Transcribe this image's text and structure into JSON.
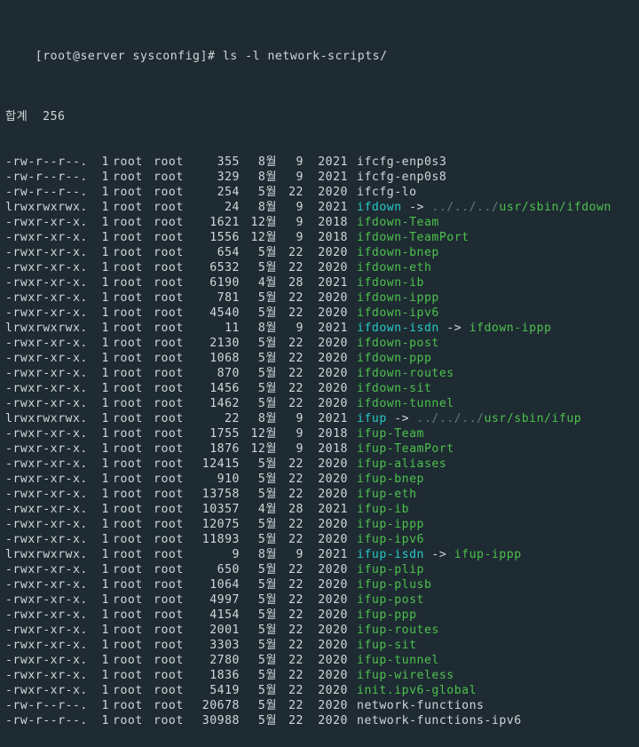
{
  "prompt": {
    "user": "root",
    "host": "server",
    "cwd": "sysconfig",
    "symbol": "#",
    "command": "ls -l network-scripts/"
  },
  "total_line": "합계  256",
  "name_colors": {
    "plain": "c-white",
    "exec": "c-green",
    "link": "c-cyan",
    "dim": "c-dim"
  },
  "rows": [
    {
      "perm": "-rw-r--r--.",
      "links": "1",
      "owner": "root",
      "group": "root",
      "size": "355",
      "month": "8월",
      "day": "9",
      "year": "2021",
      "seg": [
        {
          "t": "ifcfg-enp0s3",
          "c": "plain"
        }
      ]
    },
    {
      "perm": "-rw-r--r--.",
      "links": "1",
      "owner": "root",
      "group": "root",
      "size": "329",
      "month": "8월",
      "day": "9",
      "year": "2021",
      "seg": [
        {
          "t": "ifcfg-enp0s8",
          "c": "plain"
        }
      ]
    },
    {
      "perm": "-rw-r--r--.",
      "links": "1",
      "owner": "root",
      "group": "root",
      "size": "254",
      "month": "5월",
      "day": "22",
      "year": "2020",
      "seg": [
        {
          "t": "ifcfg-lo",
          "c": "plain"
        }
      ]
    },
    {
      "perm": "lrwxrwxrwx.",
      "links": "1",
      "owner": "root",
      "group": "root",
      "size": "24",
      "month": "8월",
      "day": "9",
      "year": "2021",
      "seg": [
        {
          "t": "ifdown",
          "c": "link"
        },
        {
          "t": " -> ",
          "c": "plain"
        },
        {
          "t": "../../../",
          "c": "dim"
        },
        {
          "t": "usr/sbin/ifdown",
          "c": "exec"
        }
      ]
    },
    {
      "perm": "-rwxr-xr-x.",
      "links": "1",
      "owner": "root",
      "group": "root",
      "size": "1621",
      "month": "12월",
      "day": "9",
      "year": "2018",
      "seg": [
        {
          "t": "ifdown-Team",
          "c": "exec"
        }
      ]
    },
    {
      "perm": "-rwxr-xr-x.",
      "links": "1",
      "owner": "root",
      "group": "root",
      "size": "1556",
      "month": "12월",
      "day": "9",
      "year": "2018",
      "seg": [
        {
          "t": "ifdown-TeamPort",
          "c": "exec"
        }
      ]
    },
    {
      "perm": "-rwxr-xr-x.",
      "links": "1",
      "owner": "root",
      "group": "root",
      "size": "654",
      "month": "5월",
      "day": "22",
      "year": "2020",
      "seg": [
        {
          "t": "ifdown-bnep",
          "c": "exec"
        }
      ]
    },
    {
      "perm": "-rwxr-xr-x.",
      "links": "1",
      "owner": "root",
      "group": "root",
      "size": "6532",
      "month": "5월",
      "day": "22",
      "year": "2020",
      "seg": [
        {
          "t": "ifdown-eth",
          "c": "exec"
        }
      ]
    },
    {
      "perm": "-rwxr-xr-x.",
      "links": "1",
      "owner": "root",
      "group": "root",
      "size": "6190",
      "month": "4월",
      "day": "28",
      "year": "2021",
      "seg": [
        {
          "t": "ifdown-ib",
          "c": "exec"
        }
      ]
    },
    {
      "perm": "-rwxr-xr-x.",
      "links": "1",
      "owner": "root",
      "group": "root",
      "size": "781",
      "month": "5월",
      "day": "22",
      "year": "2020",
      "seg": [
        {
          "t": "ifdown-ippp",
          "c": "exec"
        }
      ]
    },
    {
      "perm": "-rwxr-xr-x.",
      "links": "1",
      "owner": "root",
      "group": "root",
      "size": "4540",
      "month": "5월",
      "day": "22",
      "year": "2020",
      "seg": [
        {
          "t": "ifdown-ipv6",
          "c": "exec"
        }
      ]
    },
    {
      "perm": "lrwxrwxrwx.",
      "links": "1",
      "owner": "root",
      "group": "root",
      "size": "11",
      "month": "8월",
      "day": "9",
      "year": "2021",
      "seg": [
        {
          "t": "ifdown-isdn",
          "c": "link"
        },
        {
          "t": " -> ",
          "c": "plain"
        },
        {
          "t": "ifdown-ippp",
          "c": "exec"
        }
      ]
    },
    {
      "perm": "-rwxr-xr-x.",
      "links": "1",
      "owner": "root",
      "group": "root",
      "size": "2130",
      "month": "5월",
      "day": "22",
      "year": "2020",
      "seg": [
        {
          "t": "ifdown-post",
          "c": "exec"
        }
      ]
    },
    {
      "perm": "-rwxr-xr-x.",
      "links": "1",
      "owner": "root",
      "group": "root",
      "size": "1068",
      "month": "5월",
      "day": "22",
      "year": "2020",
      "seg": [
        {
          "t": "ifdown-ppp",
          "c": "exec"
        }
      ]
    },
    {
      "perm": "-rwxr-xr-x.",
      "links": "1",
      "owner": "root",
      "group": "root",
      "size": "870",
      "month": "5월",
      "day": "22",
      "year": "2020",
      "seg": [
        {
          "t": "ifdown-routes",
          "c": "exec"
        }
      ]
    },
    {
      "perm": "-rwxr-xr-x.",
      "links": "1",
      "owner": "root",
      "group": "root",
      "size": "1456",
      "month": "5월",
      "day": "22",
      "year": "2020",
      "seg": [
        {
          "t": "ifdown-sit",
          "c": "exec"
        }
      ]
    },
    {
      "perm": "-rwxr-xr-x.",
      "links": "1",
      "owner": "root",
      "group": "root",
      "size": "1462",
      "month": "5월",
      "day": "22",
      "year": "2020",
      "seg": [
        {
          "t": "ifdown-tunnel",
          "c": "exec"
        }
      ]
    },
    {
      "perm": "lrwxrwxrwx.",
      "links": "1",
      "owner": "root",
      "group": "root",
      "size": "22",
      "month": "8월",
      "day": "9",
      "year": "2021",
      "seg": [
        {
          "t": "ifup",
          "c": "link"
        },
        {
          "t": " -> ",
          "c": "plain"
        },
        {
          "t": "../../../",
          "c": "dim"
        },
        {
          "t": "usr/sbin/ifup",
          "c": "exec"
        }
      ]
    },
    {
      "perm": "-rwxr-xr-x.",
      "links": "1",
      "owner": "root",
      "group": "root",
      "size": "1755",
      "month": "12월",
      "day": "9",
      "year": "2018",
      "seg": [
        {
          "t": "ifup-Team",
          "c": "exec"
        }
      ]
    },
    {
      "perm": "-rwxr-xr-x.",
      "links": "1",
      "owner": "root",
      "group": "root",
      "size": "1876",
      "month": "12월",
      "day": "9",
      "year": "2018",
      "seg": [
        {
          "t": "ifup-TeamPort",
          "c": "exec"
        }
      ]
    },
    {
      "perm": "-rwxr-xr-x.",
      "links": "1",
      "owner": "root",
      "group": "root",
      "size": "12415",
      "month": "5월",
      "day": "22",
      "year": "2020",
      "seg": [
        {
          "t": "ifup-aliases",
          "c": "exec"
        }
      ]
    },
    {
      "perm": "-rwxr-xr-x.",
      "links": "1",
      "owner": "root",
      "group": "root",
      "size": "910",
      "month": "5월",
      "day": "22",
      "year": "2020",
      "seg": [
        {
          "t": "ifup-bnep",
          "c": "exec"
        }
      ]
    },
    {
      "perm": "-rwxr-xr-x.",
      "links": "1",
      "owner": "root",
      "group": "root",
      "size": "13758",
      "month": "5월",
      "day": "22",
      "year": "2020",
      "seg": [
        {
          "t": "ifup-eth",
          "c": "exec"
        }
      ]
    },
    {
      "perm": "-rwxr-xr-x.",
      "links": "1",
      "owner": "root",
      "group": "root",
      "size": "10357",
      "month": "4월",
      "day": "28",
      "year": "2021",
      "seg": [
        {
          "t": "ifup-ib",
          "c": "exec"
        }
      ]
    },
    {
      "perm": "-rwxr-xr-x.",
      "links": "1",
      "owner": "root",
      "group": "root",
      "size": "12075",
      "month": "5월",
      "day": "22",
      "year": "2020",
      "seg": [
        {
          "t": "ifup-ippp",
          "c": "exec"
        }
      ]
    },
    {
      "perm": "-rwxr-xr-x.",
      "links": "1",
      "owner": "root",
      "group": "root",
      "size": "11893",
      "month": "5월",
      "day": "22",
      "year": "2020",
      "seg": [
        {
          "t": "ifup-ipv6",
          "c": "exec"
        }
      ]
    },
    {
      "perm": "lrwxrwxrwx.",
      "links": "1",
      "owner": "root",
      "group": "root",
      "size": "9",
      "month": "8월",
      "day": "9",
      "year": "2021",
      "seg": [
        {
          "t": "ifup-isdn",
          "c": "link"
        },
        {
          "t": " -> ",
          "c": "plain"
        },
        {
          "t": "ifup-ippp",
          "c": "exec"
        }
      ]
    },
    {
      "perm": "-rwxr-xr-x.",
      "links": "1",
      "owner": "root",
      "group": "root",
      "size": "650",
      "month": "5월",
      "day": "22",
      "year": "2020",
      "seg": [
        {
          "t": "ifup-plip",
          "c": "exec"
        }
      ]
    },
    {
      "perm": "-rwxr-xr-x.",
      "links": "1",
      "owner": "root",
      "group": "root",
      "size": "1064",
      "month": "5월",
      "day": "22",
      "year": "2020",
      "seg": [
        {
          "t": "ifup-plusb",
          "c": "exec"
        }
      ]
    },
    {
      "perm": "-rwxr-xr-x.",
      "links": "1",
      "owner": "root",
      "group": "root",
      "size": "4997",
      "month": "5월",
      "day": "22",
      "year": "2020",
      "seg": [
        {
          "t": "ifup-post",
          "c": "exec"
        }
      ]
    },
    {
      "perm": "-rwxr-xr-x.",
      "links": "1",
      "owner": "root",
      "group": "root",
      "size": "4154",
      "month": "5월",
      "day": "22",
      "year": "2020",
      "seg": [
        {
          "t": "ifup-ppp",
          "c": "exec"
        }
      ]
    },
    {
      "perm": "-rwxr-xr-x.",
      "links": "1",
      "owner": "root",
      "group": "root",
      "size": "2001",
      "month": "5월",
      "day": "22",
      "year": "2020",
      "seg": [
        {
          "t": "ifup-routes",
          "c": "exec"
        }
      ]
    },
    {
      "perm": "-rwxr-xr-x.",
      "links": "1",
      "owner": "root",
      "group": "root",
      "size": "3303",
      "month": "5월",
      "day": "22",
      "year": "2020",
      "seg": [
        {
          "t": "ifup-sit",
          "c": "exec"
        }
      ]
    },
    {
      "perm": "-rwxr-xr-x.",
      "links": "1",
      "owner": "root",
      "group": "root",
      "size": "2780",
      "month": "5월",
      "day": "22",
      "year": "2020",
      "seg": [
        {
          "t": "ifup-tunnel",
          "c": "exec"
        }
      ]
    },
    {
      "perm": "-rwxr-xr-x.",
      "links": "1",
      "owner": "root",
      "group": "root",
      "size": "1836",
      "month": "5월",
      "day": "22",
      "year": "2020",
      "seg": [
        {
          "t": "ifup-wireless",
          "c": "exec"
        }
      ]
    },
    {
      "perm": "-rwxr-xr-x.",
      "links": "1",
      "owner": "root",
      "group": "root",
      "size": "5419",
      "month": "5월",
      "day": "22",
      "year": "2020",
      "seg": [
        {
          "t": "init.ipv6-global",
          "c": "exec"
        }
      ]
    },
    {
      "perm": "-rw-r--r--.",
      "links": "1",
      "owner": "root",
      "group": "root",
      "size": "20678",
      "month": "5월",
      "day": "22",
      "year": "2020",
      "seg": [
        {
          "t": "network-functions",
          "c": "plain"
        }
      ]
    },
    {
      "perm": "-rw-r--r--.",
      "links": "1",
      "owner": "root",
      "group": "root",
      "size": "30988",
      "month": "5월",
      "day": "22",
      "year": "2020",
      "seg": [
        {
          "t": "network-functions-ipv6",
          "c": "plain"
        }
      ]
    }
  ]
}
